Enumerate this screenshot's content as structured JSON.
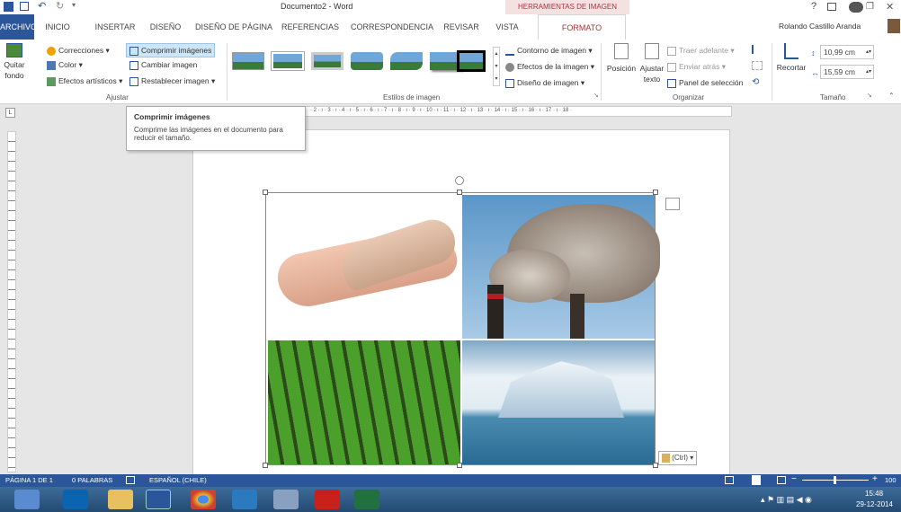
{
  "titlebar": {
    "doc_title": "Documento2 - Word",
    "context_header": "HERRAMIENTAS DE IMAGEN",
    "help": "?",
    "user": "Rolando Castillo Aranda"
  },
  "tabs": [
    "ARCHIVO",
    "INICIO",
    "INSERTAR",
    "DISEÑO",
    "DISEÑO DE PÁGINA",
    "REFERENCIAS",
    "CORRESPONDENCIA",
    "REVISAR",
    "VISTA",
    "FORMATO"
  ],
  "ribbon": {
    "ajustar": {
      "quitar_fondo_1": "Quitar",
      "quitar_fondo_2": "fondo",
      "correcciones": "Correcciones",
      "color": "Color",
      "efectos": "Efectos artísticos",
      "comprimir": "Comprimir imágenes",
      "cambiar": "Cambiar imagen",
      "restablecer": "Restablecer imagen",
      "label": "Ajustar"
    },
    "estilos": {
      "contorno": "Contorno de imagen",
      "efectos": "Efectos de la imagen",
      "diseno": "Diseño de imagen",
      "label": "Estilos de imagen"
    },
    "organizar": {
      "posicion": "Posición",
      "ajustar1": "Ajustar",
      "ajustar2": "texto",
      "traer": "Traer adelante",
      "enviar": "Enviar atrás",
      "panel": "Panel de selección",
      "label": "Organizar"
    },
    "tamano": {
      "recortar": "Recortar",
      "height": "10,99 cm",
      "width": "15,59 cm",
      "label": "Tamaño"
    }
  },
  "tooltip": {
    "title": "Comprimir imágenes",
    "text1": "Comprime las imágenes en el documento para",
    "text2": "reducir el tamaño."
  },
  "ruler": "· 2 · ı · 3 · ı · 4 · ı · 5 · ı · 6 · ı · 7 · ı · 8 · ı · 9 · ı · 10 · ı · 11 · ı · 12 · ı · 13 · ı · 14 · ı · 15 · ı · 16 · ı · 17 · ı · 18 ·",
  "ctrl_label": "(Ctrl)",
  "status": {
    "page": "PÁGINA 1 DE 1",
    "words": "0 PALABRAS",
    "lang": "ESPAÑOL (CHILE)",
    "zoom": "100"
  },
  "clock": {
    "time": "15:48",
    "date": "29-12-2014"
  },
  "colors": {
    "accent": "#2b579a",
    "context": "#a4373a"
  }
}
